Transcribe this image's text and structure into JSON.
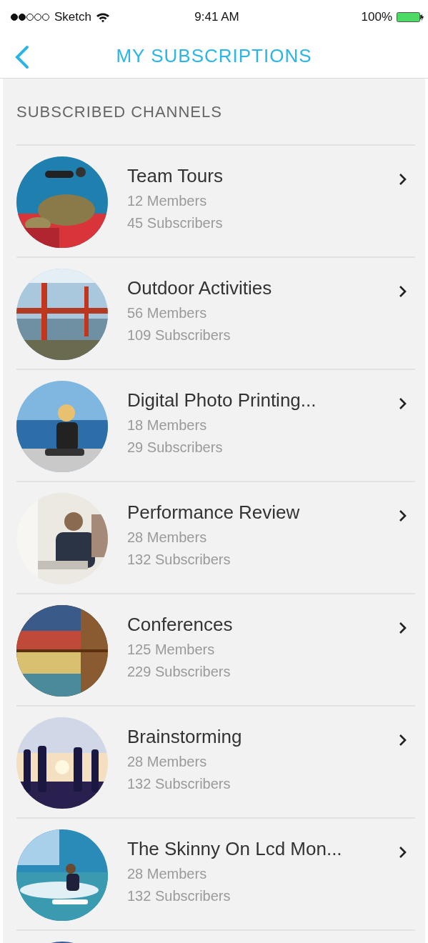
{
  "status_bar": {
    "carrier": "Sketch",
    "time": "9:41 AM",
    "battery": "100%"
  },
  "nav": {
    "title": "MY SUBSCRIPTIONS"
  },
  "section": {
    "title": "SUBSCRIBED CHANNELS"
  },
  "channels": [
    {
      "name": "Team Tours",
      "members": "12 Members",
      "subscribers": "45 Subscribers"
    },
    {
      "name": "Outdoor Activities",
      "members": "56 Members",
      "subscribers": "109 Subscribers"
    },
    {
      "name": "Digital Photo Printing...",
      "members": "18 Members",
      "subscribers": "29 Subscribers"
    },
    {
      "name": "Performance Review",
      "members": "28 Members",
      "subscribers": "132 Subscribers"
    },
    {
      "name": "Conferences",
      "members": "125 Members",
      "subscribers": "229 Subscribers"
    },
    {
      "name": "Brainstorming",
      "members": "28 Members",
      "subscribers": "132 Subscribers"
    },
    {
      "name": "The Skinny On Lcd Mon...",
      "members": "28 Members",
      "subscribers": "132 Subscribers"
    }
  ]
}
